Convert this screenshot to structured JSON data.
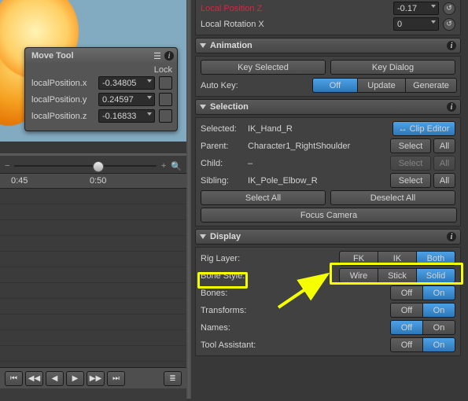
{
  "viewport": {
    "bg_color": "#6f98ad"
  },
  "move_tool": {
    "title": "Move Tool",
    "lock_label": "Lock",
    "fields": [
      {
        "label": "localPosition.x",
        "value": "-0.34805"
      },
      {
        "label": "localPosition.y",
        "value": "0.24597"
      },
      {
        "label": "localPosition.z",
        "value": "-0.16833"
      }
    ]
  },
  "timeline": {
    "ticks": [
      "0:45",
      "0:50"
    ],
    "buttons": [
      "⏮",
      "◀◀",
      "◀",
      "▶",
      "▶▶",
      "⏭"
    ]
  },
  "transform": {
    "fields": [
      {
        "label": "Local Position Z",
        "value": "-0.17",
        "warn": true
      },
      {
        "label": "Local Rotation X",
        "value": "0",
        "warn": false
      }
    ]
  },
  "animation": {
    "title": "Animation",
    "key_selected": "Key Selected",
    "key_dialog": "Key Dialog",
    "auto_key_label": "Auto Key:",
    "off": "Off",
    "update": "Update",
    "generate": "Generate"
  },
  "selection": {
    "title": "Selection",
    "rows": [
      {
        "label": "Selected:",
        "value": "IK_Hand_R"
      },
      {
        "label": "Parent:",
        "value": "Character1_RightShoulder"
      },
      {
        "label": "Child:",
        "value": "–"
      },
      {
        "label": "Sibling:",
        "value": "IK_Pole_Elbow_R"
      }
    ],
    "clip_editor": "↔ Clip Editor",
    "select": "Select",
    "all": "All",
    "select_all": "Select All",
    "deselect_all": "Deselect All",
    "focus_camera": "Focus Camera"
  },
  "display": {
    "title": "Display",
    "rows": [
      {
        "label": "Rig Layer:",
        "opts": [
          "FK",
          "IK",
          "Both"
        ],
        "active": 2
      },
      {
        "label": "Bone Style:",
        "opts": [
          "Wire",
          "Stick",
          "Solid"
        ],
        "active": 2
      },
      {
        "label": "Bones:",
        "opts": [
          "Off",
          "On"
        ],
        "active": 1
      },
      {
        "label": "Transforms:",
        "opts": [
          "Off",
          "On"
        ],
        "active": 1
      },
      {
        "label": "Names:",
        "opts": [
          "Off",
          "On"
        ],
        "active": 0
      },
      {
        "label": "Tool Assistant:",
        "opts": [
          "Off",
          "On"
        ],
        "active": 1
      }
    ]
  }
}
